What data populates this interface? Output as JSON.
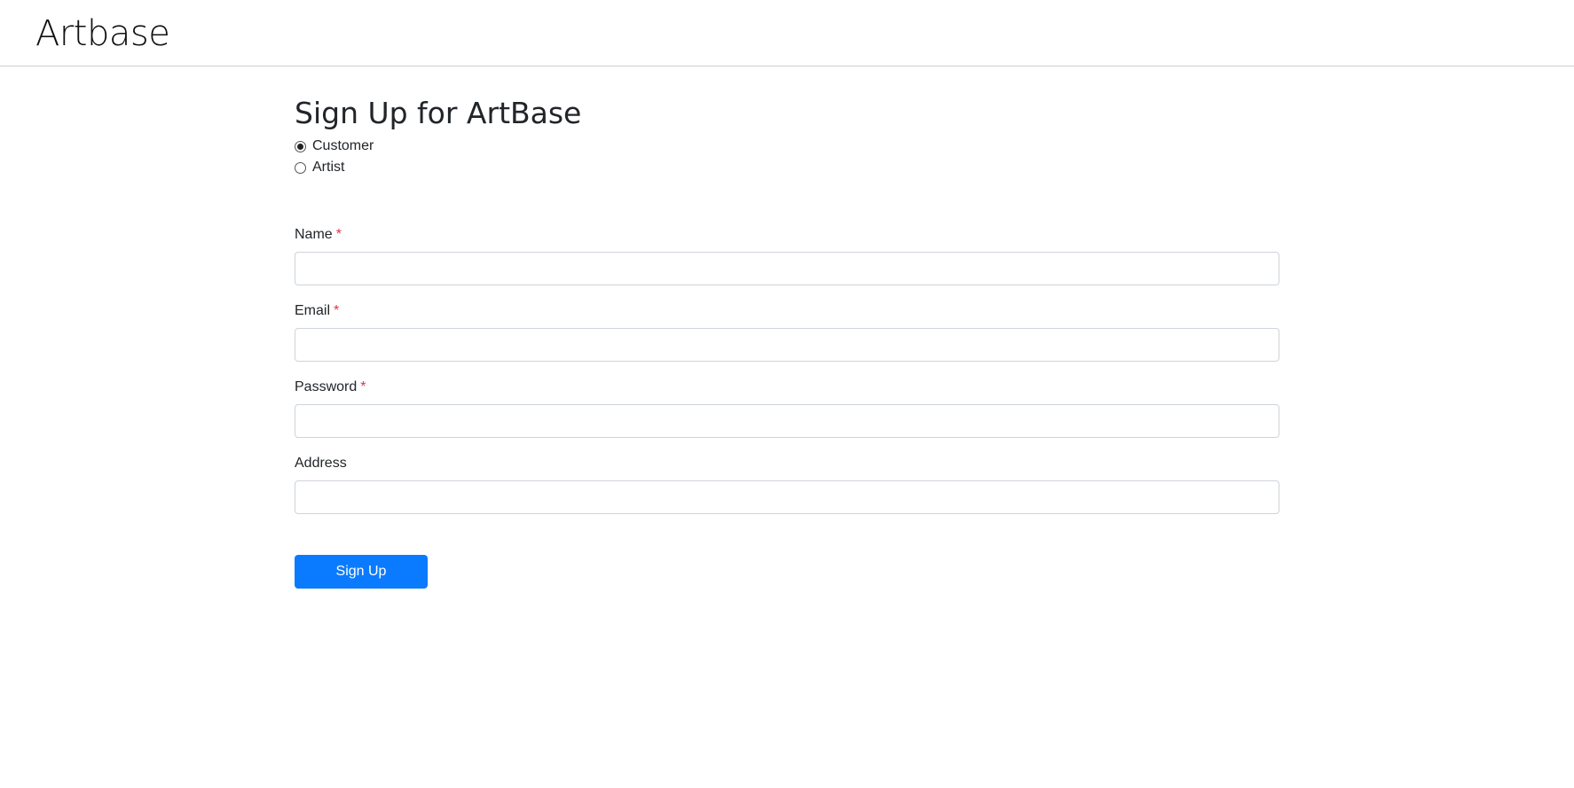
{
  "header": {
    "logo_text": "Artbase"
  },
  "page": {
    "title": "Sign Up for ArtBase"
  },
  "account_type": {
    "options": [
      {
        "label": "Customer",
        "checked": true
      },
      {
        "label": "Artist",
        "checked": false
      }
    ]
  },
  "form": {
    "required_marker": "*",
    "fields": [
      {
        "label": "Name",
        "required": true,
        "value": ""
      },
      {
        "label": "Email",
        "required": true,
        "value": ""
      },
      {
        "label": "Password",
        "required": true,
        "value": ""
      },
      {
        "label": "Address",
        "required": false,
        "value": ""
      }
    ],
    "submit_label": "Sign Up"
  },
  "colors": {
    "primary_button": "#0a7bff",
    "required_marker": "#dc3545",
    "header_border": "#cfcfcf"
  }
}
